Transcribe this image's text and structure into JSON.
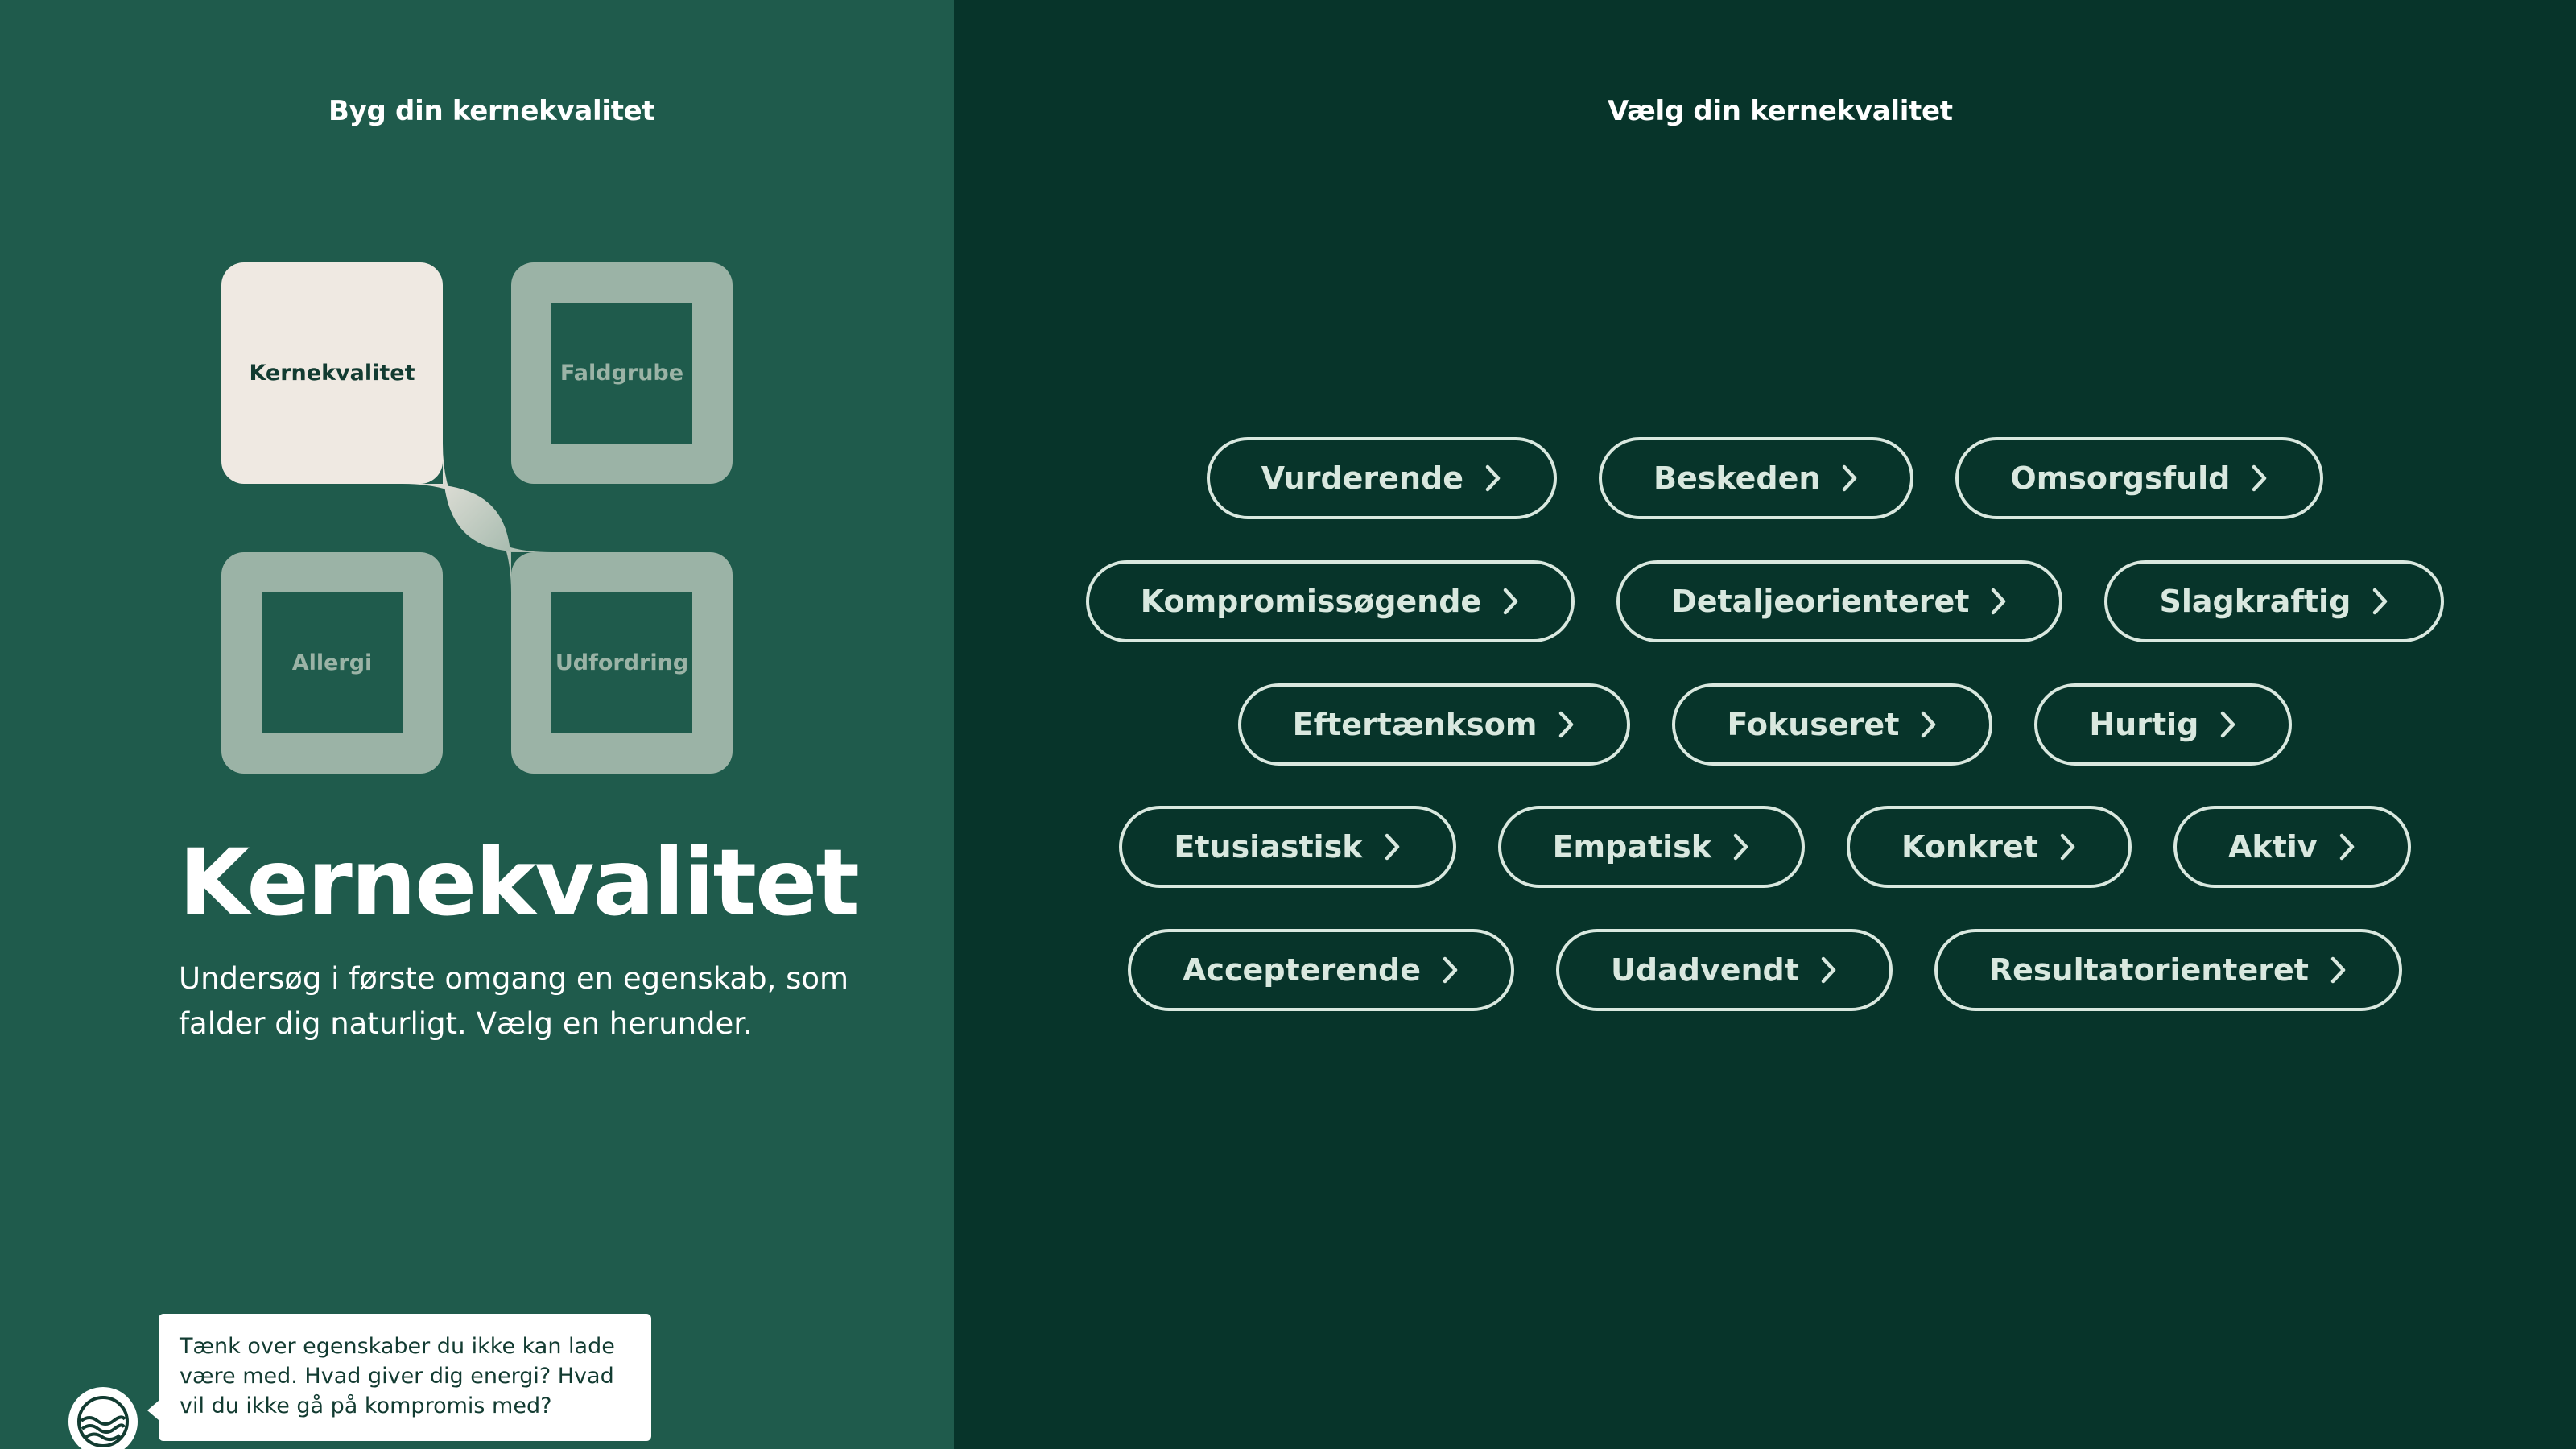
{
  "left": {
    "heading": "Byg din kernekvalitet",
    "diagram": {
      "top_left": "Kernekvalitet",
      "top_right": "Faldgrube",
      "bottom_left": "Allergi",
      "bottom_right": "Udfordring"
    },
    "title": "Kernekvalitet",
    "description": "Undersøg i første omgang en egenskab, som falder dig naturligt. Vælg en herunder.",
    "tip": "Tænk over egenskaber du ikke kan lade være med. Hvad giver dig energi? Hvad vil du ikke gå på kompromis med?"
  },
  "right": {
    "heading": "Vælg din kernekvalitet",
    "rows": [
      [
        "Vurderende",
        "Beskeden",
        "Omsorgsfuld"
      ],
      [
        "Kompromissøgende",
        "Detaljeorienteret",
        "Slagkraftig"
      ],
      [
        "Eftertænksom",
        "Fokuseret",
        "Hurtig"
      ],
      [
        "Etusiastisk",
        "Empatisk",
        "Konkret",
        "Aktiv"
      ],
      [
        "Accepterende",
        "Udadvendt",
        "Resultatorienteret"
      ]
    ]
  },
  "colors": {
    "left_bg": "#1f5b4c",
    "right_bg": "#07342a",
    "active_tile": "#efe9e2",
    "muted_tile": "#9bb3a6",
    "chip_border": "#d9e8df"
  },
  "icons": {
    "chip": "chevron-right-icon",
    "avatar": "waves-logo-icon"
  }
}
